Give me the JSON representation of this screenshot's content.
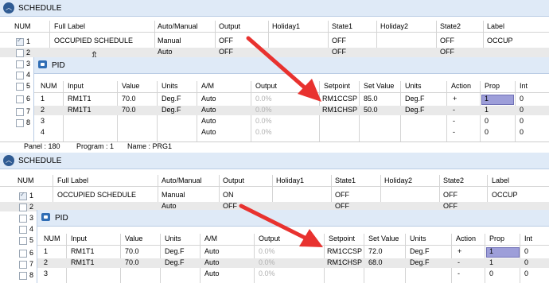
{
  "top": {
    "schedule_title": "SCHEDULE",
    "schedule_headers": [
      "NUM",
      "Full Label",
      "Auto/Manual",
      "Output",
      "Holiday1",
      "State1",
      "Holiday2",
      "State2",
      "Label"
    ],
    "schedule_rows": [
      {
        "num": "1",
        "full_label": "OCCUPIED SCHEDULE",
        "auto_manual": "Manual",
        "output": "OFF",
        "state1": "OFF",
        "state2": "OFF",
        "label": "OCCUP"
      },
      {
        "num": "2",
        "full_label": "",
        "auto_manual": "Auto",
        "output": "OFF",
        "state1": "OFF",
        "state2": "OFF",
        "label": ""
      }
    ],
    "pid_title": "PID",
    "pid_headers": [
      "NUM",
      "Input",
      "Value",
      "Units",
      "A/M",
      "Output",
      "Setpoint",
      "Set Value",
      "Units",
      "Action",
      "Prop",
      "Int"
    ],
    "pid_rows": [
      {
        "num": "1",
        "input": "RM1T1",
        "value": "70.0",
        "units": "Deg.F",
        "am": "Auto",
        "output": "0.0%",
        "setpoint": "RM1CCSP",
        "set_value": "85.0",
        "units2": "Deg.F",
        "action": "+",
        "prop": "1",
        "int": "0"
      },
      {
        "num": "2",
        "input": "RM1T1",
        "value": "70.0",
        "units": "Deg.F",
        "am": "Auto",
        "output": "0.0%",
        "setpoint": "RM1CHSP",
        "set_value": "50.0",
        "units2": "Deg.F",
        "action": "-",
        "prop": "1",
        "int": "0"
      },
      {
        "num": "3",
        "input": "",
        "value": "",
        "units": "",
        "am": "Auto",
        "output": "0.0%",
        "setpoint": "",
        "set_value": "",
        "units2": "",
        "action": "-",
        "prop": "0",
        "int": "0"
      },
      {
        "num": "4",
        "input": "",
        "value": "",
        "units": "",
        "am": "Auto",
        "output": "0.0%",
        "setpoint": "",
        "set_value": "",
        "units2": "",
        "action": "-",
        "prop": "0",
        "int": "0"
      }
    ],
    "side_nums": [
      "1",
      "2",
      "3",
      "4",
      "5",
      "6",
      "7",
      "8"
    ]
  },
  "status": {
    "panel": "Panel : 180",
    "program": "Program : 1",
    "name": "Name : PRG1"
  },
  "bottom": {
    "schedule_title": "SCHEDULE",
    "schedule_headers": [
      "NUM",
      "Full Label",
      "Auto/Manual",
      "Output",
      "Holiday1",
      "State1",
      "Holiday2",
      "State2",
      "Label"
    ],
    "schedule_rows": [
      {
        "num": "1",
        "full_label": "OCCUPIED SCHEDULE",
        "auto_manual": "Manual",
        "output": "ON",
        "state1": "OFF",
        "state2": "OFF",
        "label": "OCCUP"
      },
      {
        "num": "2",
        "full_label": "",
        "auto_manual": "Auto",
        "output": "OFF",
        "state1": "OFF",
        "state2": "OFF",
        "label": ""
      }
    ],
    "pid_title": "PID",
    "pid_headers": [
      "NUM",
      "Input",
      "Value",
      "Units",
      "A/M",
      "Output",
      "Setpoint",
      "Set Value",
      "Units",
      "Action",
      "Prop",
      "Int"
    ],
    "pid_rows": [
      {
        "num": "1",
        "input": "RM1T1",
        "value": "70.0",
        "units": "Deg.F",
        "am": "Auto",
        "output": "0.0%",
        "setpoint": "RM1CCSP",
        "set_value": "72.0",
        "units2": "Deg.F",
        "action": "+",
        "prop": "1",
        "int": "0"
      },
      {
        "num": "2",
        "input": "RM1T1",
        "value": "70.0",
        "units": "Deg.F",
        "am": "Auto",
        "output": "0.0%",
        "setpoint": "RM1CHSP",
        "set_value": "68.0",
        "units2": "Deg.F",
        "action": "-",
        "prop": "1",
        "int": "0"
      },
      {
        "num": "3",
        "input": "",
        "value": "",
        "units": "",
        "am": "Auto",
        "output": "0.0%",
        "setpoint": "",
        "set_value": "",
        "units2": "",
        "action": "-",
        "prop": "0",
        "int": "0"
      }
    ],
    "side_nums": [
      "1",
      "2",
      "3",
      "4",
      "5",
      "6",
      "7",
      "8"
    ]
  },
  "colors": {
    "header_bg": "#dfeaf7",
    "selected_cell": "#9d9ed9",
    "arrow": "#e8322f",
    "row_alt": "#e9e9e9"
  }
}
